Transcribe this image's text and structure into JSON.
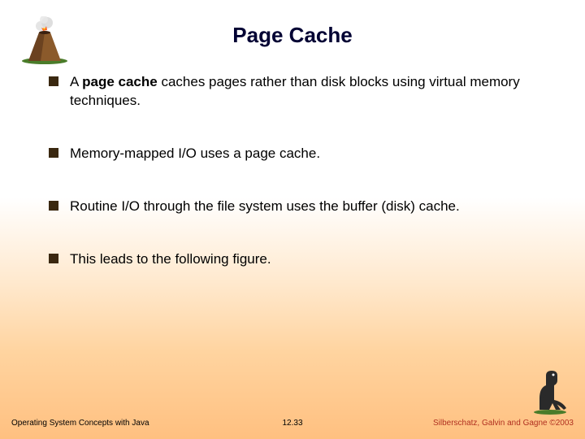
{
  "title": "Page Cache",
  "bullets": [
    {
      "prefix": "A ",
      "bold": "page cache",
      "suffix": " caches pages rather than disk blocks using virtual memory techniques."
    },
    {
      "prefix": "",
      "bold": "",
      "suffix": "Memory-mapped I/O uses a page cache."
    },
    {
      "prefix": "",
      "bold": "",
      "suffix": "Routine I/O through the file system uses the buffer (disk) cache."
    },
    {
      "prefix": "",
      "bold": "",
      "suffix": "This leads to the following figure."
    }
  ],
  "footer": {
    "left": "Operating System Concepts with Java",
    "center": "12.33",
    "right": "Silberschatz, Galvin and Gagne ©2003"
  },
  "icons": {
    "volcano": "volcano-icon",
    "dino": "dinosaur-icon"
  }
}
